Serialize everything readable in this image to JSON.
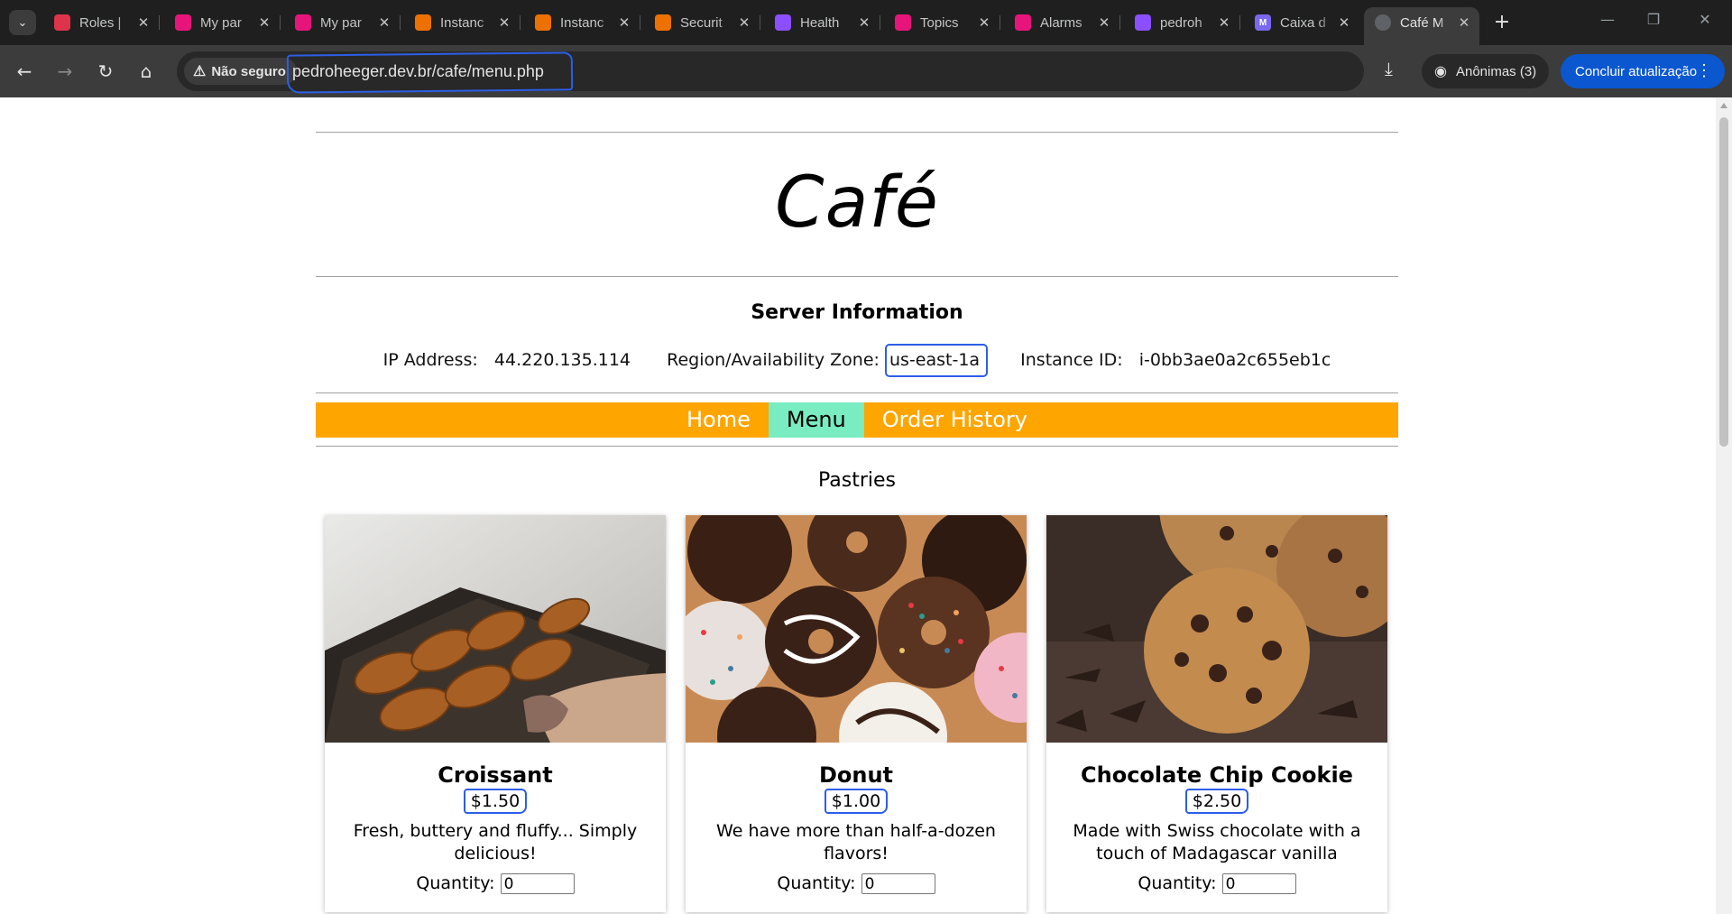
{
  "browser": {
    "tabs": [
      {
        "title": "Roles | ",
        "icon": "aws-iam-icon",
        "color": "#dd344c"
      },
      {
        "title": "My par",
        "icon": "aws-console-icon",
        "color": "#e7157b"
      },
      {
        "title": "My par",
        "icon": "aws-console-icon",
        "color": "#e7157b"
      },
      {
        "title": "Instanc",
        "icon": "aws-ec2-icon",
        "color": "#ed7100"
      },
      {
        "title": "Instanc",
        "icon": "aws-ec2-icon",
        "color": "#ed7100"
      },
      {
        "title": "Securit",
        "icon": "aws-ec2-icon",
        "color": "#ed7100"
      },
      {
        "title": "Health",
        "icon": "aws-health-icon",
        "color": "#8c4fff"
      },
      {
        "title": "Topics",
        "icon": "aws-sns-icon",
        "color": "#e7157b"
      },
      {
        "title": "Alarms",
        "icon": "aws-cloudwatch-icon",
        "color": "#e7157b"
      },
      {
        "title": "pedroh",
        "icon": "aws-cognito-icon",
        "color": "#8c4fff"
      },
      {
        "title": "Caixa d",
        "icon": "mail-icon",
        "color": "#7b68ee"
      },
      {
        "title": "Café M",
        "icon": "globe-icon",
        "color": "#5f6368"
      }
    ],
    "insecure_label": "Não seguro",
    "url": "pedroheeger.dev.br/cafe/menu.php",
    "incognito_label": "Anônimas (3)",
    "update_label": "Concluir atualização"
  },
  "page": {
    "logo": "Café",
    "server_info": {
      "title": "Server Information",
      "ip_label": "IP Address:",
      "ip_value": "44.220.135.114",
      "zone_label": "Region/Availability Zone:",
      "zone_value": "us-east-1a",
      "instance_label": "Instance ID:",
      "instance_value": "i-0bb3ae0a2c655eb1c"
    },
    "nav": {
      "home": "Home",
      "menu": "Menu",
      "history": "Order History"
    },
    "section_title": "Pastries",
    "quantity_label": "Quantity:",
    "products": [
      {
        "name": "Croissant",
        "price": "$1.50",
        "description": "Fresh, buttery and fluffy... Simply delicious!",
        "quantity": "0"
      },
      {
        "name": "Donut",
        "price": "$1.00",
        "description": "We have more than half-a-dozen flavors!",
        "quantity": "0"
      },
      {
        "name": "Chocolate Chip Cookie",
        "price": "$2.50",
        "description": "Made with Swiss chocolate with a touch of Madagascar vanilla",
        "quantity": "0"
      }
    ]
  }
}
